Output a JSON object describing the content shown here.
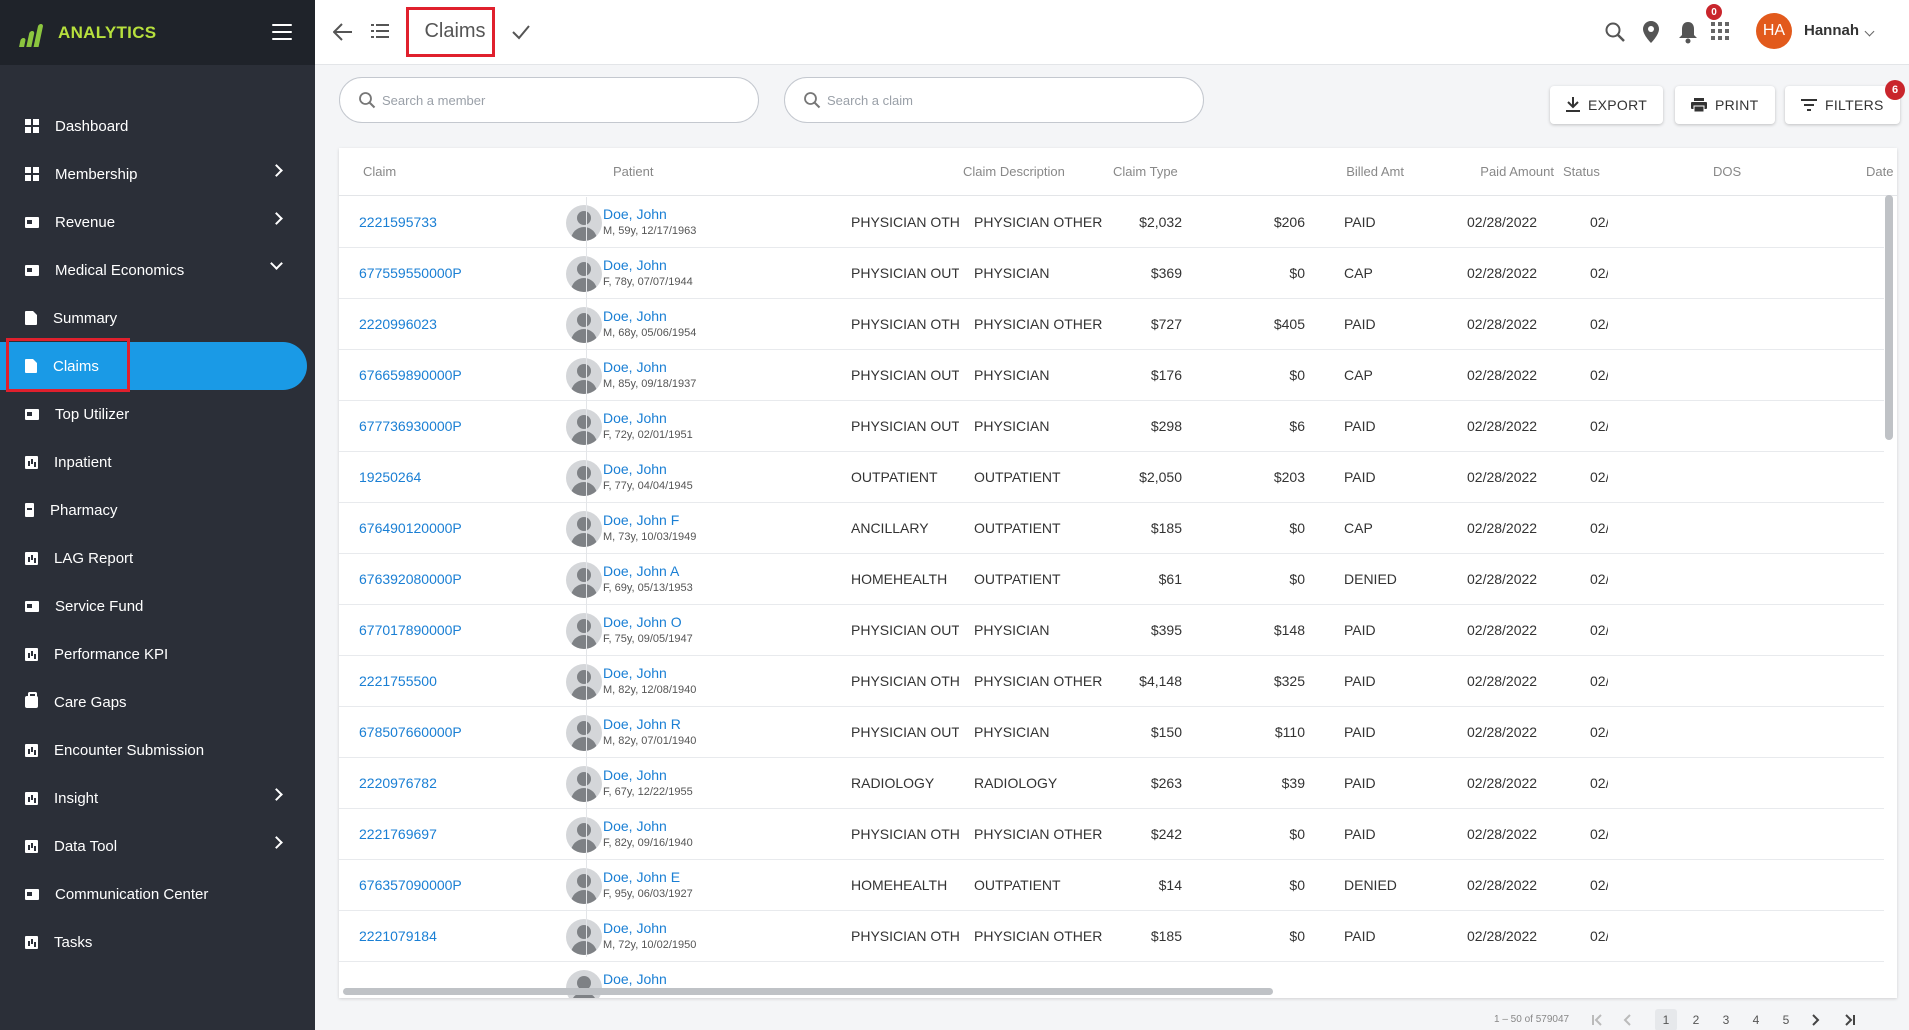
{
  "sidebar": {
    "brand": "ANALYTICS",
    "items": [
      {
        "label": "Dashboard",
        "icon": "grid"
      },
      {
        "label": "Membership",
        "icon": "grid",
        "chevron": "right"
      },
      {
        "label": "Revenue",
        "icon": "card",
        "chevron": "right"
      },
      {
        "label": "Medical Economics",
        "icon": "card",
        "chevron": "down"
      },
      {
        "label": "Summary",
        "icon": "doc"
      },
      {
        "label": "Claims",
        "icon": "doc",
        "active": true
      },
      {
        "label": "Top Utilizer",
        "icon": "card"
      },
      {
        "label": "Inpatient",
        "icon": "chartbox"
      },
      {
        "label": "Pharmacy",
        "icon": "bottle"
      },
      {
        "label": "LAG Report",
        "icon": "chartbox"
      },
      {
        "label": "Service Fund",
        "icon": "card"
      },
      {
        "label": "Performance KPI",
        "icon": "chartbox"
      },
      {
        "label": "Care Gaps",
        "icon": "bag"
      },
      {
        "label": "Encounter Submission",
        "icon": "chartbox"
      },
      {
        "label": "Insight",
        "icon": "chartbox",
        "chevron": "right"
      },
      {
        "label": "Data Tool",
        "icon": "chartbox",
        "chevron": "right"
      },
      {
        "label": "Communication Center",
        "icon": "card"
      },
      {
        "label": "Tasks",
        "icon": "chartbox"
      }
    ]
  },
  "topbar": {
    "title": "Claims",
    "notification_count": "0",
    "avatar_initials": "HA",
    "user_name": "Hannah"
  },
  "search": {
    "member_placeholder": "Search a member",
    "claim_placeholder": "Search a claim"
  },
  "actions": {
    "export": "EXPORT",
    "print": "PRINT",
    "filters": "FILTERS",
    "filters_count": "6"
  },
  "table": {
    "headers": {
      "claim": "Claim",
      "patient": "Patient",
      "description": "Claim Description",
      "type": "Claim Type",
      "billed": "Billed Amt",
      "paid": "Paid Amount",
      "status": "Status",
      "dos": "DOS",
      "date": "Date"
    },
    "rows": [
      {
        "claim": "2221595733",
        "name": "Doe, John",
        "info": "M, 59y, 12/17/1963",
        "desc": "PHYSICIAN OTHER",
        "type": "PHYSICIAN OTHER",
        "billed": "$2,032",
        "paid": "$206",
        "status": "PAID",
        "dos": "02/28/2022",
        "date": "02/"
      },
      {
        "claim": "677559550000P",
        "name": "Doe, John",
        "info": "F, 78y, 07/07/1944",
        "desc": "PHYSICIAN OUTPAT",
        "type": "PHYSICIAN",
        "billed": "$369",
        "paid": "$0",
        "status": "CAP",
        "dos": "02/28/2022",
        "date": "02/"
      },
      {
        "claim": "2220996023",
        "name": "Doe, John",
        "info": "M, 68y, 05/06/1954",
        "desc": "PHYSICIAN OTHER",
        "type": "PHYSICIAN OTHER",
        "billed": "$727",
        "paid": "$405",
        "status": "PAID",
        "dos": "02/28/2022",
        "date": "02/"
      },
      {
        "claim": "676659890000P",
        "name": "Doe, John",
        "info": "M, 85y, 09/18/1937",
        "desc": "PHYSICIAN OUTPAT",
        "type": "PHYSICIAN",
        "billed": "$176",
        "paid": "$0",
        "status": "CAP",
        "dos": "02/28/2022",
        "date": "02/"
      },
      {
        "claim": "677736930000P",
        "name": "Doe, John",
        "info": "F, 72y, 02/01/1951",
        "desc": "PHYSICIAN OUTPAT",
        "type": "PHYSICIAN",
        "billed": "$298",
        "paid": "$6",
        "status": "PAID",
        "dos": "02/28/2022",
        "date": "02/"
      },
      {
        "claim": "19250264",
        "name": "Doe, John",
        "info": "F, 77y, 04/04/1945",
        "desc": "OUTPATIENT",
        "type": "OUTPATIENT",
        "billed": "$2,050",
        "paid": "$203",
        "status": "PAID",
        "dos": "02/28/2022",
        "date": "02/"
      },
      {
        "claim": "676490120000P",
        "name": "Doe, John F",
        "info": "M, 73y, 10/03/1949",
        "desc": "ANCILLARY",
        "type": "OUTPATIENT",
        "billed": "$185",
        "paid": "$0",
        "status": "CAP",
        "dos": "02/28/2022",
        "date": "02/"
      },
      {
        "claim": "676392080000P",
        "name": "Doe, John A",
        "info": "F, 69y, 05/13/1953",
        "desc": "HOMEHEALTH",
        "type": "OUTPATIENT",
        "billed": "$61",
        "paid": "$0",
        "status": "DENIED",
        "dos": "02/28/2022",
        "date": "02/"
      },
      {
        "claim": "677017890000P",
        "name": "Doe, John O",
        "info": "F, 75y, 09/05/1947",
        "desc": "PHYSICIAN OUTPAT",
        "type": "PHYSICIAN",
        "billed": "$395",
        "paid": "$148",
        "status": "PAID",
        "dos": "02/28/2022",
        "date": "02/"
      },
      {
        "claim": "2221755500",
        "name": "Doe, John",
        "info": "M, 82y, 12/08/1940",
        "desc": "PHYSICIAN OTHER",
        "type": "PHYSICIAN OTHER",
        "billed": "$4,148",
        "paid": "$325",
        "status": "PAID",
        "dos": "02/28/2022",
        "date": "02/"
      },
      {
        "claim": "678507660000P",
        "name": "Doe, John R",
        "info": "M, 82y, 07/01/1940",
        "desc": "PHYSICIAN OUTPAT",
        "type": "PHYSICIAN",
        "billed": "$150",
        "paid": "$110",
        "status": "PAID",
        "dos": "02/28/2022",
        "date": "02/"
      },
      {
        "claim": "2220976782",
        "name": "Doe, John",
        "info": "F, 67y, 12/22/1955",
        "desc": "RADIOLOGY",
        "type": "RADIOLOGY",
        "billed": "$263",
        "paid": "$39",
        "status": "PAID",
        "dos": "02/28/2022",
        "date": "02/"
      },
      {
        "claim": "2221769697",
        "name": "Doe, John",
        "info": "F, 82y, 09/16/1940",
        "desc": "PHYSICIAN OTHER",
        "type": "PHYSICIAN OTHER",
        "billed": "$242",
        "paid": "$0",
        "status": "PAID",
        "dos": "02/28/2022",
        "date": "02/"
      },
      {
        "claim": "676357090000P",
        "name": "Doe, John E",
        "info": "F, 95y, 06/03/1927",
        "desc": "HOMEHEALTH",
        "type": "OUTPATIENT",
        "billed": "$14",
        "paid": "$0",
        "status": "DENIED",
        "dos": "02/28/2022",
        "date": "02/"
      },
      {
        "claim": "2221079184",
        "name": "Doe, John",
        "info": "M, 72y, 10/02/1950",
        "desc": "PHYSICIAN OTHER",
        "type": "PHYSICIAN OTHER",
        "billed": "$185",
        "paid": "$0",
        "status": "PAID",
        "dos": "02/28/2022",
        "date": "02/"
      },
      {
        "claim": "",
        "name": "Doe, John",
        "info": "",
        "desc": "",
        "type": "",
        "billed": "",
        "paid": "",
        "status": "",
        "dos": "",
        "date": ""
      }
    ]
  },
  "pagination": {
    "range": "1 – 50 of 579047",
    "pages": [
      "1",
      "2",
      "3",
      "4",
      "5"
    ],
    "current": "1"
  },
  "colors": {
    "sidebar_bg": "#2b2f38",
    "accent": "#1a9ae6",
    "brand": "#b7e03d",
    "link": "#1a7fd4",
    "badge": "#c9252c",
    "highlight": "#e0202d"
  }
}
